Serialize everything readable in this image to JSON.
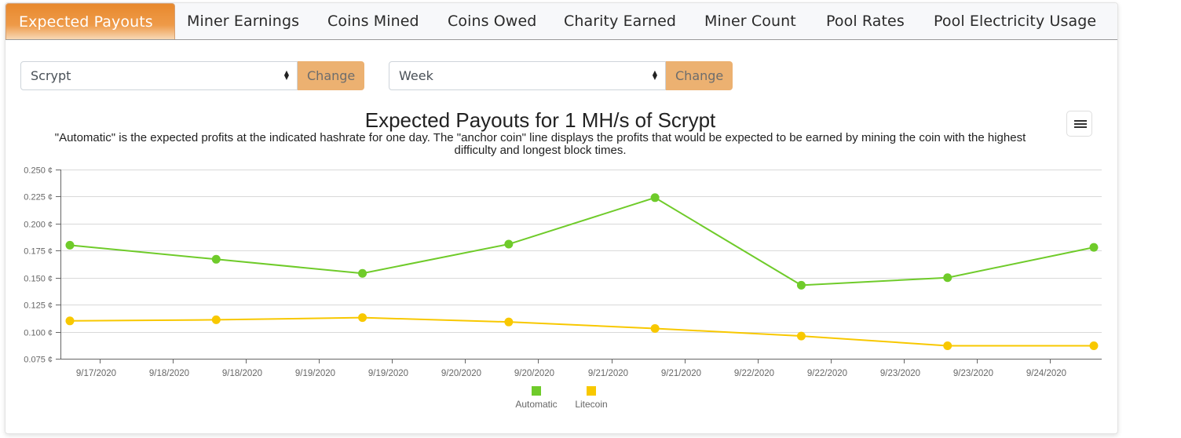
{
  "tabs": [
    {
      "label": "Expected Payouts",
      "active": true
    },
    {
      "label": "Miner Earnings",
      "active": false
    },
    {
      "label": "Coins Mined",
      "active": false
    },
    {
      "label": "Coins Owed",
      "active": false
    },
    {
      "label": "Charity Earned",
      "active": false
    },
    {
      "label": "Miner Count",
      "active": false
    },
    {
      "label": "Pool Rates",
      "active": false
    },
    {
      "label": "Pool Electricity Usage",
      "active": false
    }
  ],
  "controls": {
    "algorithm_select": {
      "value": "Scrypt",
      "button_label": "Change"
    },
    "period_select": {
      "value": "Week",
      "button_label": "Change"
    }
  },
  "chart_menu": {
    "icon": "hamburger-menu-icon"
  },
  "colors": {
    "accent": "#e8892d",
    "change_button": "#ecb171",
    "automatic": "#6fcb2a",
    "litecoin": "#f8c800"
  },
  "chart_data": {
    "type": "line",
    "title": "Expected Payouts for 1 MH/s of Scrypt",
    "subtitle": "\"Automatic\" is the expected profits at the indicated hashrate for one day. The \"anchor coin\" line displays the profits that would be expected to be earned by mining the coin with the highest difficulty and longest block times.",
    "xlabel": "",
    "ylabel": "",
    "y_unit_suffix": " ¢",
    "ylim": [
      0.075,
      0.25
    ],
    "yticks": [
      "0.250 ¢",
      "0.225 ¢",
      "0.200 ¢",
      "0.175 ¢",
      "0.150 ¢",
      "0.125 ¢",
      "0.100 ¢",
      "0.075 ¢"
    ],
    "ytick_values": [
      0.25,
      0.225,
      0.2,
      0.175,
      0.15,
      0.125,
      0.1,
      0.075
    ],
    "xticks": [
      "9/17/2020",
      "9/18/2020",
      "9/18/2020",
      "9/19/2020",
      "9/19/2020",
      "9/20/2020",
      "9/20/2020",
      "9/21/2020",
      "9/21/2020",
      "9/22/2020",
      "9/22/2020",
      "9/23/2020",
      "9/23/2020",
      "9/24/2020"
    ],
    "grid": true,
    "legend": "bottom-center",
    "series": [
      {
        "name": "Automatic",
        "color": "#6fcb2a",
        "values": [
          0.18,
          0.167,
          0.154,
          0.181,
          0.224,
          0.143,
          0.15,
          0.178
        ]
      },
      {
        "name": "Litecoin",
        "color": "#f8c800",
        "values": [
          0.11,
          0.111,
          0.113,
          0.109,
          0.103,
          0.096,
          0.087,
          0.087
        ]
      }
    ]
  }
}
